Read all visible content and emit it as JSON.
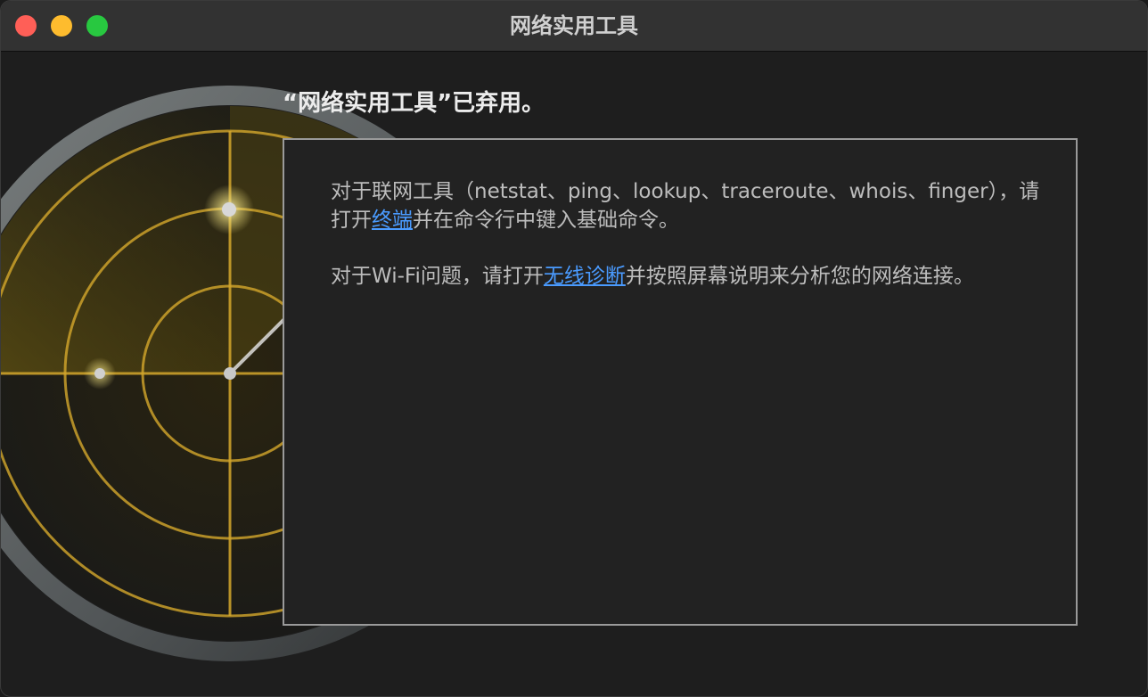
{
  "window": {
    "title": "网络实用工具"
  },
  "main": {
    "heading": "“网络实用工具”已弃用。",
    "para1": {
      "text_before": "对于联网工具（netstat、ping、lookup、traceroute、whois、finger），请打开",
      "link": "终端",
      "text_after": "并在命令行中键入基础命令。"
    },
    "para2": {
      "text_before": "对于Wi-Fi问题，请打开",
      "link": "无线诊断",
      "text_after": "并按照屏幕说明来分析您的网络连接。"
    }
  },
  "colors": {
    "link": "#4a9bff",
    "radar_gold": "#d4a72c",
    "close": "#ff5f57",
    "minimize": "#febc2e",
    "maximize": "#28c840"
  },
  "icons": [
    "radar-icon"
  ]
}
